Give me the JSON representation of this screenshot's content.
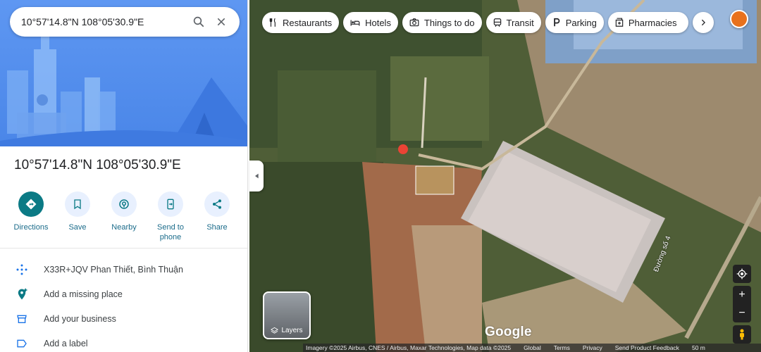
{
  "search": {
    "value": "10°57'14.8\"N 108°05'30.9\"E"
  },
  "place": {
    "title": "10°57'14.8\"N 108°05'30.9\"E"
  },
  "actions": [
    {
      "label": "Directions",
      "icon": "directions-icon"
    },
    {
      "label": "Save",
      "icon": "bookmark-icon"
    },
    {
      "label": "Nearby",
      "icon": "nearby-icon"
    },
    {
      "label": "Send to\nphone",
      "icon": "send-to-phone-icon"
    },
    {
      "label": "Share",
      "icon": "share-icon"
    }
  ],
  "info": [
    {
      "text": "X33R+JQV Phan Thiết, Bình Thuận",
      "icon": "plus-code-icon"
    },
    {
      "text": "Add a missing place",
      "icon": "add-place-icon"
    },
    {
      "text": "Add your business",
      "icon": "business-icon"
    },
    {
      "text": "Add a label",
      "icon": "label-icon"
    }
  ],
  "chips": [
    {
      "label": "Restaurants",
      "icon": "restaurant-icon"
    },
    {
      "label": "Hotels",
      "icon": "hotel-icon"
    },
    {
      "label": "Things to do",
      "icon": "camera-icon"
    },
    {
      "label": "Transit",
      "icon": "transit-icon"
    },
    {
      "label": "Parking",
      "icon": "parking-icon"
    },
    {
      "label": "Pharmacies",
      "icon": "pharmacy-icon"
    }
  ],
  "map": {
    "layers_label": "Layers",
    "google_logo": "Google",
    "road_label": "Đường số 4",
    "footer": {
      "imagery": "Imagery ©2025 Airbus, CNES / Airbus, Maxar Technologies, Map data ©2025",
      "global": "Global",
      "terms": "Terms",
      "privacy": "Privacy",
      "feedback": "Send Product Feedback",
      "scale": "50 m"
    }
  },
  "colors": {
    "accent": "#0b7a85",
    "action_bg": "#e8f0fe",
    "action_text": "#1a6b8a",
    "hero": "#4a86e8",
    "pin": "#ea4335"
  }
}
